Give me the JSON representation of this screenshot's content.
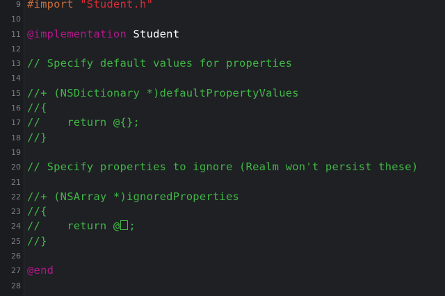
{
  "editor": {
    "lines": [
      {
        "num": "9",
        "parts": [
          {
            "cls": "c-directive",
            "text": "#import "
          },
          {
            "cls": "c-string",
            "text": "\"Student.h\""
          }
        ]
      },
      {
        "num": "10",
        "parts": []
      },
      {
        "num": "11",
        "parts": [
          {
            "cls": "c-keyword",
            "text": "@implementation"
          },
          {
            "cls": "c-plain",
            "text": " Student"
          }
        ]
      },
      {
        "num": "12",
        "parts": []
      },
      {
        "num": "13",
        "parts": [
          {
            "cls": "c-comment",
            "text": "// Specify default values for properties"
          }
        ]
      },
      {
        "num": "14",
        "parts": []
      },
      {
        "num": "15",
        "parts": [
          {
            "cls": "c-comment",
            "text": "//+ (NSDictionary *)defaultPropertyValues"
          }
        ]
      },
      {
        "num": "16",
        "parts": [
          {
            "cls": "c-comment",
            "text": "//{"
          }
        ]
      },
      {
        "num": "17",
        "parts": [
          {
            "cls": "c-comment",
            "text": "//    return @{};"
          }
        ]
      },
      {
        "num": "18",
        "parts": [
          {
            "cls": "c-comment",
            "text": "//}"
          }
        ]
      },
      {
        "num": "19",
        "parts": []
      },
      {
        "num": "20",
        "parts": [
          {
            "cls": "c-comment",
            "text": "// Specify properties to ignore (Realm won't persist these)"
          }
        ]
      },
      {
        "num": "21",
        "parts": []
      },
      {
        "num": "22",
        "parts": [
          {
            "cls": "c-comment",
            "text": "//+ (NSArray *)ignoredProperties"
          }
        ]
      },
      {
        "num": "23",
        "parts": [
          {
            "cls": "c-comment",
            "text": "//{"
          }
        ]
      },
      {
        "num": "24",
        "parts": [
          {
            "cls": "c-comment",
            "text": "//    return @"
          },
          {
            "cls": "box",
            "text": "[]"
          },
          {
            "cls": "c-comment",
            "text": ";"
          }
        ]
      },
      {
        "num": "25",
        "parts": [
          {
            "cls": "c-comment",
            "text": "//}"
          }
        ]
      },
      {
        "num": "26",
        "parts": []
      },
      {
        "num": "27",
        "parts": [
          {
            "cls": "c-keyword",
            "text": "@end"
          }
        ]
      },
      {
        "num": "28",
        "parts": []
      }
    ],
    "colors": {
      "background": "#1e2024",
      "comment": "#41b645",
      "directive": "#c86e3a",
      "string": "#db2c38",
      "keyword": "#b21889",
      "plain": "#ffffff",
      "line_number": "#7c7f84"
    }
  }
}
